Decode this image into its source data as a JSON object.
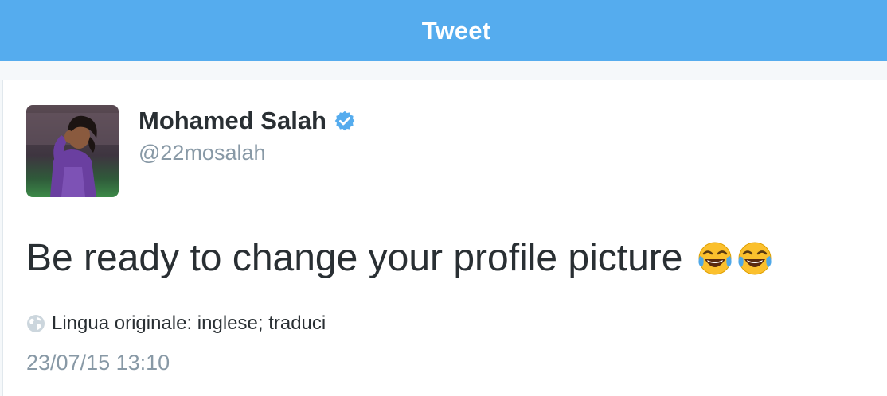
{
  "header": {
    "title": "Tweet"
  },
  "tweet": {
    "author": {
      "name": "Mohamed Salah",
      "handle": "@22mosalah",
      "verified": true
    },
    "text": "Be ready to change your profile picture",
    "emojis": [
      "face-with-tears-of-joy-icon",
      "face-with-tears-of-joy-icon"
    ],
    "translation": {
      "label": "Lingua originale: inglese; traduci"
    },
    "timestamp": "23/07/15 13:10"
  },
  "colors": {
    "header_bg": "#55acee",
    "verified": "#1da1f2",
    "text": "#292f33",
    "muted": "#8899a6"
  }
}
